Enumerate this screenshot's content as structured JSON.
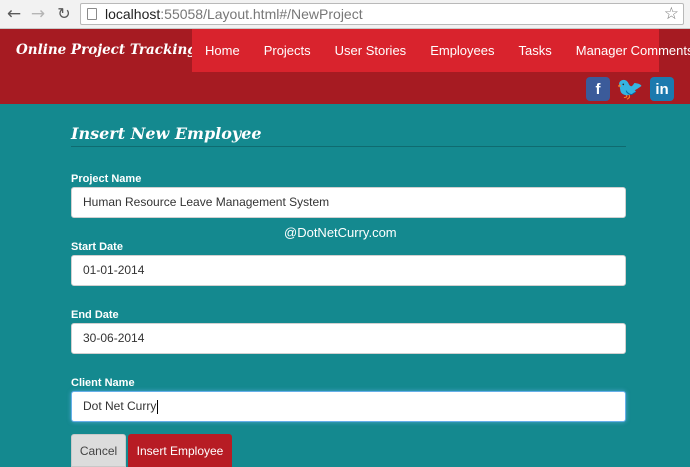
{
  "browser": {
    "url_host": "localhost",
    "url_rest": ":55058/Layout.html#/NewProject"
  },
  "site": {
    "brand": "Online Project Tracking Site",
    "menu": [
      {
        "label": "Home"
      },
      {
        "label": "Projects"
      },
      {
        "label": "User Stories"
      },
      {
        "label": "Employees"
      },
      {
        "label": "Tasks"
      },
      {
        "label": "Manager Comments"
      }
    ],
    "social": {
      "facebook": "f",
      "twitter": "🐦",
      "linkedin": "in"
    }
  },
  "form": {
    "title": "Insert New Employee",
    "fields": [
      {
        "label": "Project Name",
        "value": "Human Resource Leave Management System"
      },
      {
        "label": "Start Date",
        "value": "01-01-2014"
      },
      {
        "label": "End Date",
        "value": "30-06-2014"
      },
      {
        "label": "Client Name",
        "value": "Dot Net Curry"
      }
    ],
    "cancel_label": "Cancel",
    "submit_label": "Insert Employee"
  },
  "watermark": "@DotNetCurry.com"
}
